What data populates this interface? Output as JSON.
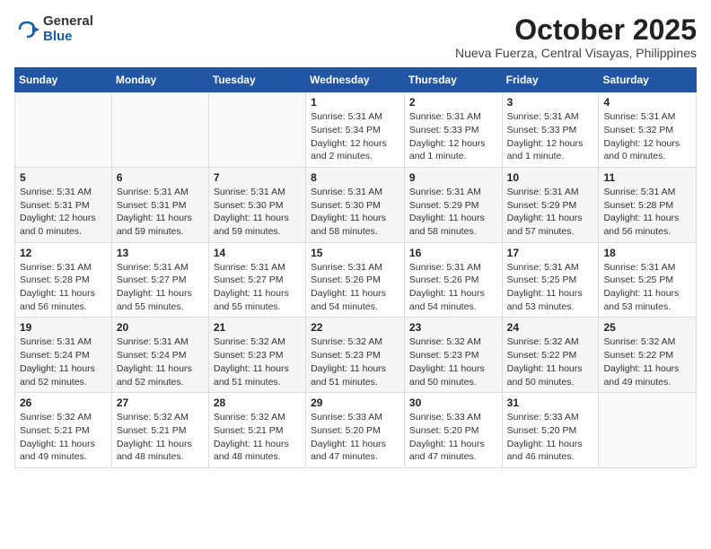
{
  "header": {
    "logo_general": "General",
    "logo_blue": "Blue",
    "month_title": "October 2025",
    "location": "Nueva Fuerza, Central Visayas, Philippines"
  },
  "days_of_week": [
    "Sunday",
    "Monday",
    "Tuesday",
    "Wednesday",
    "Thursday",
    "Friday",
    "Saturday"
  ],
  "weeks": [
    [
      {
        "day": "",
        "content": ""
      },
      {
        "day": "",
        "content": ""
      },
      {
        "day": "",
        "content": ""
      },
      {
        "day": "1",
        "content": "Sunrise: 5:31 AM\nSunset: 5:34 PM\nDaylight: 12 hours and 2 minutes."
      },
      {
        "day": "2",
        "content": "Sunrise: 5:31 AM\nSunset: 5:33 PM\nDaylight: 12 hours and 1 minute."
      },
      {
        "day": "3",
        "content": "Sunrise: 5:31 AM\nSunset: 5:33 PM\nDaylight: 12 hours and 1 minute."
      },
      {
        "day": "4",
        "content": "Sunrise: 5:31 AM\nSunset: 5:32 PM\nDaylight: 12 hours and 0 minutes."
      }
    ],
    [
      {
        "day": "5",
        "content": "Sunrise: 5:31 AM\nSunset: 5:31 PM\nDaylight: 12 hours and 0 minutes."
      },
      {
        "day": "6",
        "content": "Sunrise: 5:31 AM\nSunset: 5:31 PM\nDaylight: 11 hours and 59 minutes."
      },
      {
        "day": "7",
        "content": "Sunrise: 5:31 AM\nSunset: 5:30 PM\nDaylight: 11 hours and 59 minutes."
      },
      {
        "day": "8",
        "content": "Sunrise: 5:31 AM\nSunset: 5:30 PM\nDaylight: 11 hours and 58 minutes."
      },
      {
        "day": "9",
        "content": "Sunrise: 5:31 AM\nSunset: 5:29 PM\nDaylight: 11 hours and 58 minutes."
      },
      {
        "day": "10",
        "content": "Sunrise: 5:31 AM\nSunset: 5:29 PM\nDaylight: 11 hours and 57 minutes."
      },
      {
        "day": "11",
        "content": "Sunrise: 5:31 AM\nSunset: 5:28 PM\nDaylight: 11 hours and 56 minutes."
      }
    ],
    [
      {
        "day": "12",
        "content": "Sunrise: 5:31 AM\nSunset: 5:28 PM\nDaylight: 11 hours and 56 minutes."
      },
      {
        "day": "13",
        "content": "Sunrise: 5:31 AM\nSunset: 5:27 PM\nDaylight: 11 hours and 55 minutes."
      },
      {
        "day": "14",
        "content": "Sunrise: 5:31 AM\nSunset: 5:27 PM\nDaylight: 11 hours and 55 minutes."
      },
      {
        "day": "15",
        "content": "Sunrise: 5:31 AM\nSunset: 5:26 PM\nDaylight: 11 hours and 54 minutes."
      },
      {
        "day": "16",
        "content": "Sunrise: 5:31 AM\nSunset: 5:26 PM\nDaylight: 11 hours and 54 minutes."
      },
      {
        "day": "17",
        "content": "Sunrise: 5:31 AM\nSunset: 5:25 PM\nDaylight: 11 hours and 53 minutes."
      },
      {
        "day": "18",
        "content": "Sunrise: 5:31 AM\nSunset: 5:25 PM\nDaylight: 11 hours and 53 minutes."
      }
    ],
    [
      {
        "day": "19",
        "content": "Sunrise: 5:31 AM\nSunset: 5:24 PM\nDaylight: 11 hours and 52 minutes."
      },
      {
        "day": "20",
        "content": "Sunrise: 5:31 AM\nSunset: 5:24 PM\nDaylight: 11 hours and 52 minutes."
      },
      {
        "day": "21",
        "content": "Sunrise: 5:32 AM\nSunset: 5:23 PM\nDaylight: 11 hours and 51 minutes."
      },
      {
        "day": "22",
        "content": "Sunrise: 5:32 AM\nSunset: 5:23 PM\nDaylight: 11 hours and 51 minutes."
      },
      {
        "day": "23",
        "content": "Sunrise: 5:32 AM\nSunset: 5:23 PM\nDaylight: 11 hours and 50 minutes."
      },
      {
        "day": "24",
        "content": "Sunrise: 5:32 AM\nSunset: 5:22 PM\nDaylight: 11 hours and 50 minutes."
      },
      {
        "day": "25",
        "content": "Sunrise: 5:32 AM\nSunset: 5:22 PM\nDaylight: 11 hours and 49 minutes."
      }
    ],
    [
      {
        "day": "26",
        "content": "Sunrise: 5:32 AM\nSunset: 5:21 PM\nDaylight: 11 hours and 49 minutes."
      },
      {
        "day": "27",
        "content": "Sunrise: 5:32 AM\nSunset: 5:21 PM\nDaylight: 11 hours and 48 minutes."
      },
      {
        "day": "28",
        "content": "Sunrise: 5:32 AM\nSunset: 5:21 PM\nDaylight: 11 hours and 48 minutes."
      },
      {
        "day": "29",
        "content": "Sunrise: 5:33 AM\nSunset: 5:20 PM\nDaylight: 11 hours and 47 minutes."
      },
      {
        "day": "30",
        "content": "Sunrise: 5:33 AM\nSunset: 5:20 PM\nDaylight: 11 hours and 47 minutes."
      },
      {
        "day": "31",
        "content": "Sunrise: 5:33 AM\nSunset: 5:20 PM\nDaylight: 11 hours and 46 minutes."
      },
      {
        "day": "",
        "content": ""
      }
    ]
  ]
}
